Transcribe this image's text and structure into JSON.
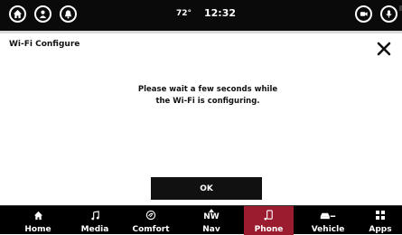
{
  "status": {
    "temperature": "72°",
    "time": "12:32"
  },
  "dialog": {
    "title": "Wi-Fi Configure",
    "message_line1": "Please wait a few seconds while",
    "message_line2": "the Wi-Fi is configuring.",
    "ok_label": "OK"
  },
  "nav": {
    "home": "Home",
    "media": "Media",
    "comfort": "Comfort",
    "nav_label": "Nav",
    "compass": "NW",
    "phone": "Phone",
    "vehicle": "Vehicle",
    "apps": "Apps",
    "active": "Phone",
    "active_color": "#9b1c2e"
  },
  "icons": {
    "top_left": [
      "home-icon",
      "driver-profile-icon",
      "notification-bell-icon"
    ],
    "top_right": [
      "camera-icon",
      "voice-command-icon"
    ]
  }
}
